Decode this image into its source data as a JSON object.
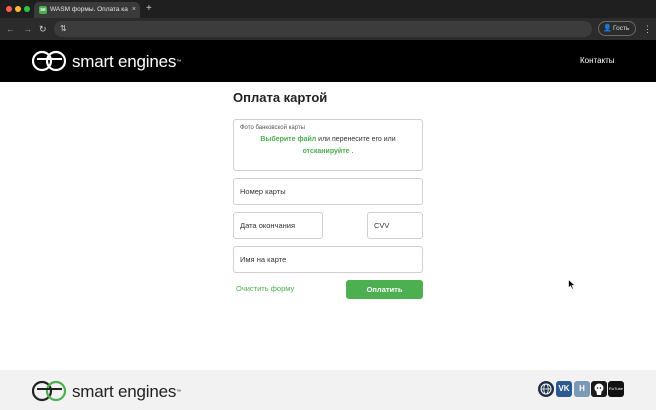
{
  "browser": {
    "tab_title": "WASM формы. Оплата картой",
    "tab_favicon": "se",
    "tab_close": "×",
    "new_tab": "+",
    "back": "←",
    "forward": "→",
    "reload": "↻",
    "site_icon": "⇅",
    "guest_label": "Гость",
    "guest_icon": "👤",
    "menu": "⋮"
  },
  "header": {
    "logo_text": "smart engines",
    "logo_tm": "™",
    "contacts": "Контакты"
  },
  "form": {
    "title": "Оплата картой",
    "upload": {
      "label": "Фото банковской карты",
      "choose_file": "Выберите файл",
      "middle_text": " или перенесите его или",
      "scan": "отсканируйте",
      "end_text": " ."
    },
    "card_number_placeholder": "Номер карты",
    "expiry_placeholder": "Дата окончания",
    "cvv_placeholder": "CVV",
    "name_placeholder": "Имя на карте",
    "clear_label": "Очистить форму",
    "pay_label": "Оплатить"
  },
  "footer": {
    "logo_text": "smart engines",
    "logo_tm": "™",
    "social": {
      "s2": "VK",
      "s3": "H",
      "s5": "RuTube"
    }
  },
  "colors": {
    "accent": "#4caf50",
    "header_bg": "#000000",
    "footer_bg": "#f2f2f2"
  },
  "icons": [
    "se-logo-icon",
    "globe-icon",
    "vk-icon",
    "habr-icon",
    "github-icon",
    "rutube-icon",
    "cursor-icon"
  ]
}
